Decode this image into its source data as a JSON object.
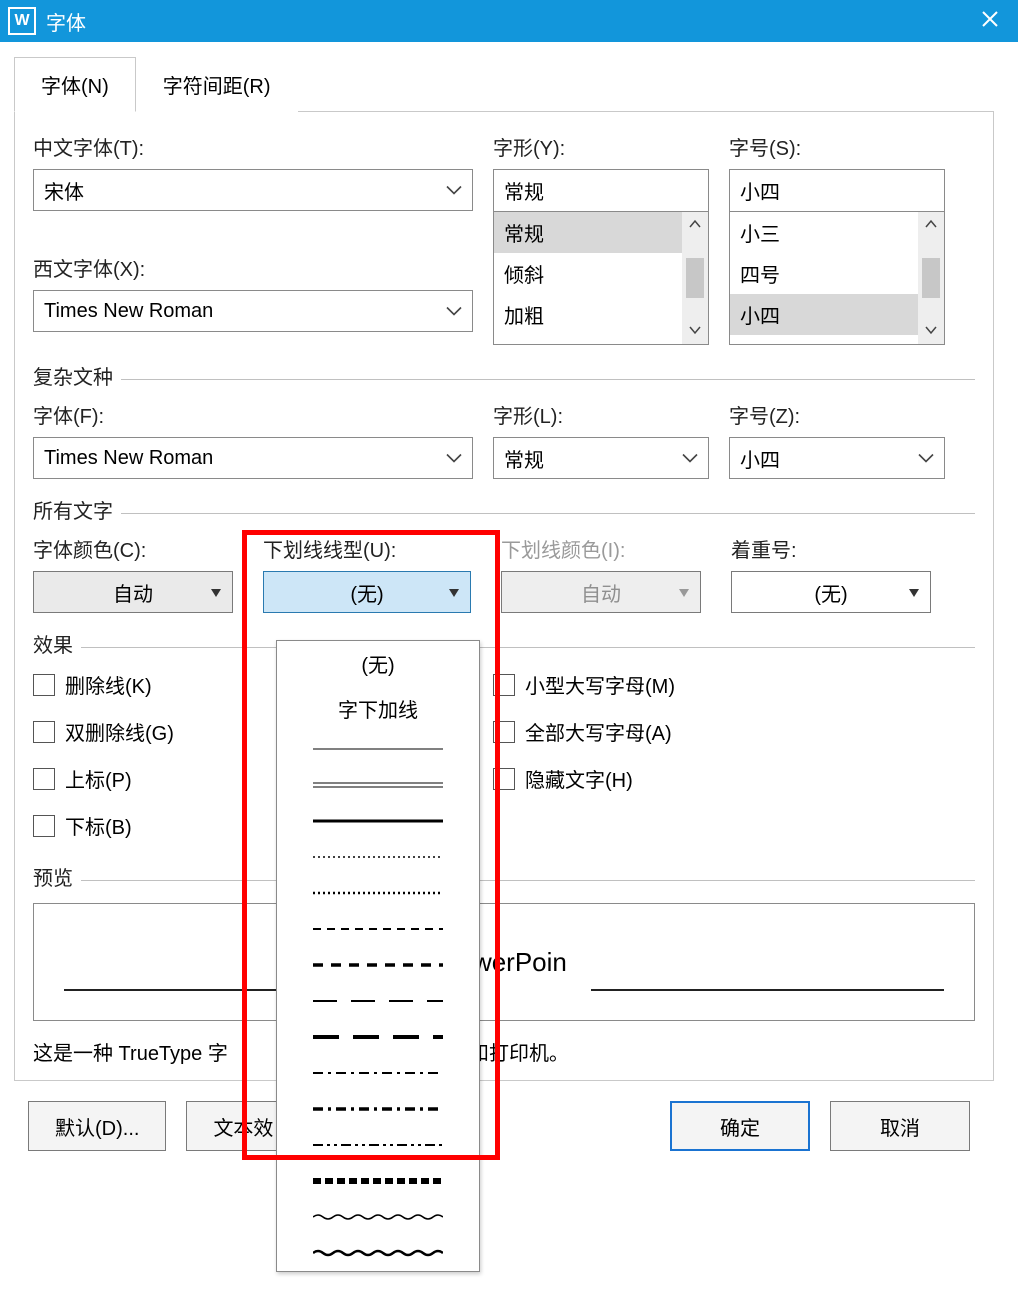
{
  "title": "字体",
  "tabs": {
    "font": "字体(N)",
    "spacing": "字符间距(R)"
  },
  "labels": {
    "cn_font": "中文字体(T):",
    "style": "字形(Y):",
    "size": "字号(S):",
    "west_font": "西文字体(X):",
    "complex_section": "复杂文种",
    "c_font": "字体(F):",
    "c_style": "字形(L):",
    "c_size": "字号(Z):",
    "all_text": "所有文字",
    "font_color": "字体颜色(C):",
    "underline_style": "下划线线型(U):",
    "underline_color": "下划线颜色(I):",
    "emphasis": "着重号:",
    "effects": "效果",
    "preview": "预览"
  },
  "values": {
    "cn_font": "宋体",
    "west_font": "Times New Roman",
    "style_input": "常规",
    "size_input": "小四",
    "c_font": "Times New Roman",
    "c_style": "常规",
    "c_size": "小四",
    "font_color": "自动",
    "underline_style": "(无)",
    "underline_color": "自动",
    "emphasis": "(无)"
  },
  "style_list": [
    "常规",
    "倾斜",
    "加粗"
  ],
  "size_list": [
    "小三",
    "四号",
    "小四"
  ],
  "underline_options": {
    "none": "(无)",
    "words": "字下加线"
  },
  "effects_checks": {
    "strike": "删除线(K)",
    "dstrike": "双删除线(G)",
    "sup": "上标(P)",
    "sub": "下标(B)",
    "smallcaps": "小型大写字母(M)",
    "allcaps": "全部大写字母(A)",
    "hidden": "隐藏文字(H)"
  },
  "preview_text": "PowerPoin",
  "truetype_note_left": "这是一种 TrueType 字",
  "truetype_note_right": "和打印机。",
  "buttons": {
    "default": "默认(D)...",
    "text_effects": "文本效",
    "ok": "确定",
    "cancel": "取消"
  }
}
